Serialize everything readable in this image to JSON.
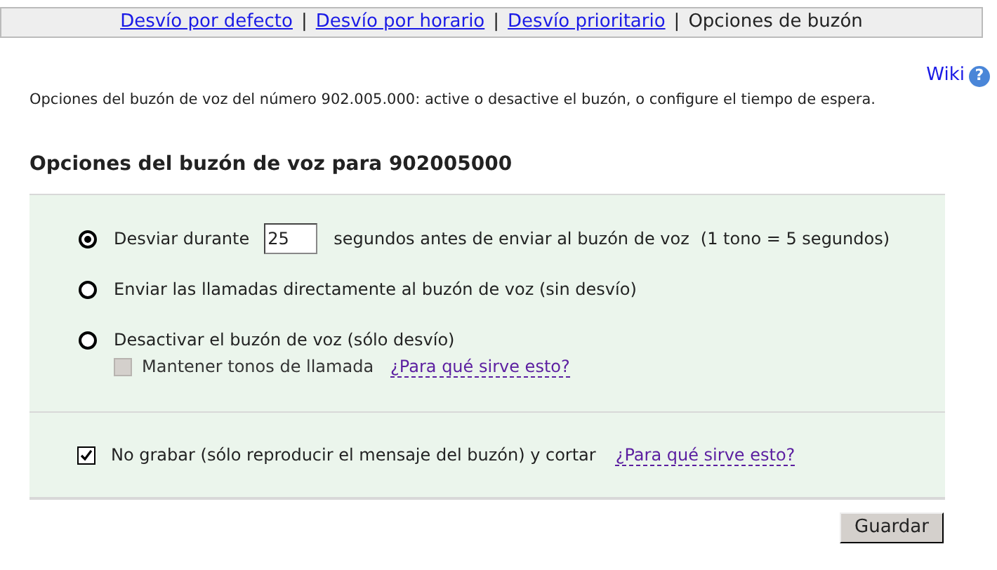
{
  "nav": [
    {
      "kind": "link",
      "label": "Desvío por defecto",
      "selected": false
    },
    {
      "kind": "separator",
      "label": "|"
    },
    {
      "kind": "link",
      "label": "Desvío por horario",
      "selected": false
    },
    {
      "kind": "separator",
      "label": "|"
    },
    {
      "kind": "link",
      "label": "Desvío prioritario",
      "selected": false
    },
    {
      "kind": "separator",
      "label": "|"
    },
    {
      "kind": "link",
      "label": "Opciones de buzón",
      "selected": true
    }
  ],
  "wiki": {
    "label": "Wiki",
    "help_icon": "?"
  },
  "description": "Opciones del buzón de voz del número 902.005.000: active o desactive el buzón, o configure el tiempo de espera.",
  "heading": "Opciones del buzón de voz para 902005000",
  "options": [
    {
      "selected": true,
      "label": "Desviar durante",
      "value": "25",
      "suffix": "segundos antes de enviar al buzón de voz",
      "note": "(1 tono = 5 segundos)"
    },
    {
      "selected": false,
      "label": "Enviar las llamadas directamente al buzón de voz (sin desvío)"
    },
    {
      "selected": false,
      "label": "Desactivar el buzón de voz (sólo desvío)",
      "sub_option": {
        "label": "Mantener tonos de llamada",
        "checked": false,
        "disabled": true,
        "help_link": "¿Para qué sirve esto?"
      }
    }
  ],
  "no_record": {
    "label": "No grabar (sólo reproducir el mensaje del buzón) y cortar",
    "checked": true,
    "help_link": "¿Para qué sirve esto?"
  },
  "save_button": "Guardar"
}
